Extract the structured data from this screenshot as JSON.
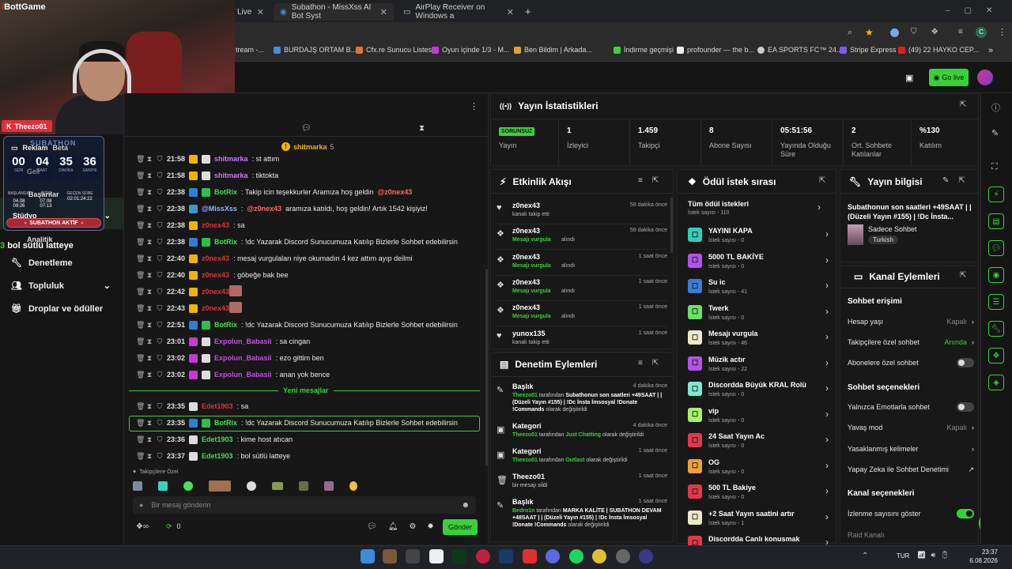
{
  "tabs": [
    {
      "label": "Live"
    },
    {
      "label": "Subathon - MissXss AI Bot Syst"
    },
    {
      "label": "AirPlay Receiver on Windows a"
    }
  ],
  "bookmarks": [
    {
      "label": "tream -..."
    },
    {
      "label": "BURDAJŞ ORTAM B..."
    },
    {
      "label": "Cfx.re Sunucu Listesi"
    },
    {
      "label": "Oyun içinde 1/3 - M..."
    },
    {
      "label": "Ben Bildim | Arkada..."
    },
    {
      "label": "İndirme geçmişi"
    },
    {
      "label": "profounder — the b..."
    },
    {
      "label": "EA SPORTS FC™ 24..."
    },
    {
      "label": "Stripe Express"
    },
    {
      "label": "(49) 22 HAYKO CEP..."
    }
  ],
  "topnav": {
    "go_live": "Go live"
  },
  "overlay": {
    "brand": "BottGame",
    "username": "Theezo01",
    "reklam": "Reklam",
    "beta": "Beta",
    "subathon_title": "SUBATHON",
    "timer": [
      {
        "v": "00",
        "l": "GÜN"
      },
      {
        "v": "04",
        "l": "SAAT"
      },
      {
        "v": "35",
        "l": "DAKİKA"
      },
      {
        "v": "36",
        "l": "SANİYE"
      }
    ],
    "geli": "Geli",
    "basarilar": "Başarılar",
    "stats": [
      {
        "l": "BAŞLANGIÇ",
        "v": "04.08",
        "v2": "09:26"
      },
      {
        "l": "BİTİŞ",
        "v": "07.08",
        "v2": "07:13"
      },
      {
        "l": "GEÇEN SÜRE",
        "v": "02:01:24:22"
      }
    ],
    "studyo": "Stüdyo",
    "aktif": "SUBATHON AKTİF",
    "analitik": "Analitik",
    "latteye": "bol sütlü latteye"
  },
  "sidebar": {
    "items": [
      {
        "label": "Denetleme"
      },
      {
        "label": "Topluluk"
      },
      {
        "label": "Droplar ve ödüller"
      }
    ]
  },
  "chat": {
    "pinned_user": "shitmarka",
    "pinned_count": "5",
    "messages": [
      {
        "time": "21:58",
        "user": "shitmarka",
        "text": ": st attım",
        "color": "#c879ff",
        "b": [
          "g",
          "w"
        ]
      },
      {
        "time": "21:58",
        "user": "shitmarka",
        "text": ": tiktokta",
        "color": "#c879ff",
        "b": [
          "g",
          "w"
        ]
      },
      {
        "time": "22:38",
        "user": "BotRix",
        "text": ": Takip icin teşekkurler Aramıza hoş geldin ",
        "mention": "@z0nex43",
        "color": "#3fe04f",
        "b": [
          "bl",
          "gr"
        ]
      },
      {
        "time": "22:38",
        "user": "@MissXss",
        "text": ": ",
        "mention": "@z0nex43",
        "after": " aramıza katıldı, hoş geldin! Artık 1542 kişiyiz!",
        "color": "#8fb7ff",
        "b": [
          "c"
        ]
      },
      {
        "time": "22:38",
        "user": "z0nex43",
        "text": ": sa",
        "color": "#e0343a",
        "b": [
          "g"
        ]
      },
      {
        "time": "22:38",
        "user": "BotRix",
        "text": ": !dc Yazarak Discord Sunucumuza Katılıp Bizlerle Sohbet edebilirsin",
        "color": "#3fe04f",
        "b": [
          "bl",
          "gr"
        ]
      },
      {
        "time": "22:40",
        "user": "z0nex43",
        "text": ": mesaj vurgulaları niye okumadın 4 kez attım ayıp deilmi",
        "color": "#e0343a",
        "b": [
          "g"
        ]
      },
      {
        "time": "22:40",
        "user": "z0nex43",
        "text": ": göbeğe bak bee",
        "color": "#e0343a",
        "b": [
          "g"
        ]
      },
      {
        "time": "22:42",
        "user": "z0nex43",
        "text": ":",
        "color": "#e0343a",
        "b": [
          "g"
        ]
      },
      {
        "time": "22:43",
        "user": "z0nex43",
        "text": ":",
        "color": "#e0343a",
        "b": [
          "g"
        ]
      },
      {
        "time": "22:51",
        "user": "BotRix",
        "text": ": !dc Yazarak Discord Sunucumuza Katılıp Bizlerle Sohbet edebilirsin",
        "color": "#3fe04f",
        "b": [
          "bl",
          "gr"
        ]
      },
      {
        "time": "23:01",
        "user": "Expolun_Babasii",
        "text": ": sa cingan",
        "color": "#c34fe0",
        "b": [
          "p",
          "w"
        ]
      },
      {
        "time": "23:02",
        "user": "Expolun_Babasii",
        "text": ": ezo gittim ben",
        "color": "#c34fe0",
        "b": [
          "p",
          "w"
        ]
      },
      {
        "time": "23:02",
        "user": "Expolun_Babasii",
        "text": ": anan yok bence",
        "color": "#c34fe0",
        "b": [
          "p",
          "w"
        ]
      }
    ],
    "new_messages": "Yeni mesajlar",
    "messages2": [
      {
        "time": "23:35",
        "user": "Edet1903",
        "text": ": sa",
        "color": "#e0343a",
        "b": [
          "w"
        ]
      },
      {
        "time": "23:35",
        "user": "BotRix",
        "text": ": !dc Yazarak Discord Sunucumuza Katılıp Bizlerle Sohbet edebilirsin",
        "color": "#3fe04f",
        "b": [
          "bl",
          "gr"
        ]
      },
      {
        "time": "23:36",
        "user": "Edet1903",
        "text": ": kime host atıcan",
        "color": "#3fe04f",
        "b": [
          "w"
        ]
      },
      {
        "time": "23:37",
        "user": "Edet1903",
        "text": ": bol sütlü latteye",
        "color": "#3fe04f",
        "b": [
          "w"
        ]
      }
    ],
    "follower_label": "Takipçilere Özel",
    "input_placeholder": "Bir mesaj gönderin",
    "points": "0",
    "send": "Gönder"
  },
  "stream_stats": {
    "title": "Yayın İstatistikleri",
    "items": [
      {
        "v": "SORUNSUZ",
        "l": "Yayın"
      },
      {
        "v": "1",
        "l": "İzleyici"
      },
      {
        "v": "1.459",
        "l": "Takipçi"
      },
      {
        "v": "8",
        "l": "Abone Sayısı"
      },
      {
        "v": "05:51:56",
        "l": "Yayında Olduğu Süre"
      },
      {
        "v": "2",
        "l": "Ort. Sohbete Katılanlar"
      },
      {
        "v": "%130",
        "l": "Katılım"
      }
    ]
  },
  "activity": {
    "title": "Etkinlik Akışı",
    "rows": [
      {
        "n": "z0nex43",
        "s": "kanalı takip etti",
        "t": "58 dakika önce",
        "hl": false,
        "icon": "♥"
      },
      {
        "n": "z0nex43",
        "s": "Mesajı vurgula",
        "s2": " alındı",
        "t": "59 dakika önce",
        "hl": true,
        "icon": "❖"
      },
      {
        "n": "z0nex43",
        "s": "Mesajı vurgula",
        "s2": " alındı",
        "t": "1 saat önce",
        "hl": true,
        "icon": "❖"
      },
      {
        "n": "z0nex43",
        "s": "Mesajı vurgula",
        "s2": " alındı",
        "t": "1 saat önce",
        "hl": true,
        "icon": "❖"
      },
      {
        "n": "z0nex43",
        "s": "Mesajı vurgula",
        "s2": " alındı",
        "t": "1 saat önce",
        "hl": true,
        "icon": "❖"
      },
      {
        "n": "yunox135",
        "s": "kanalı takip etti",
        "t": "1 saat önce",
        "hl": false,
        "icon": "♥"
      }
    ]
  },
  "moderation": {
    "title": "Denetim Eylemleri",
    "rows": [
      {
        "n": "Başlık",
        "t": "4 dakika önce",
        "u": "Theezo01",
        "d": " tarafından ",
        "v": "Subathonun son saatleri +49SAAT | | (Düzeli Yayın #155) | !Dc İnsta İmsosyal !Donate !Commands",
        "e": " olarak değiştirildi"
      },
      {
        "n": "Kategori",
        "t": "4 dakika önce",
        "u": "Theezo01",
        "d": " tarafından ",
        "hl": "Just Chatting",
        "e": " olarak değiştirildi"
      },
      {
        "n": "Kategori",
        "t": "1 saat önce",
        "u": "Theezo01",
        "d": " tarafından ",
        "hl": "Outlast",
        "e": " olarak değiştirildi"
      },
      {
        "n": "Theezo01",
        "t": "1 saat önce",
        "sub": "bir mesajı sildi"
      },
      {
        "n": "Başlık",
        "t": "1 saat önce",
        "u": "Bedro1n",
        "d": " tarafından ",
        "v": "MARKA KALİTE | SUBATHON DEVAM +48SAAT | | (Düzeli Yayın #155) | !Dc İnsta İmsosyal !Donate !Commands",
        "e": " olarak değiştirildi"
      }
    ]
  },
  "rewards": {
    "title": "Ödül istek sırası",
    "all": "Tüm ödül istekleri",
    "all_count": "İstek sayısı - 110",
    "items": [
      {
        "n": "YAYINI KAPA",
        "s": "İstek sayısı - 0",
        "c": "#2fd0b8"
      },
      {
        "n": "5000 TL BAKİYE",
        "s": "İstek sayısı - 0",
        "c": "#b255e6"
      },
      {
        "n": "Su ic",
        "s": "İstek sayısı - 41",
        "c": "#3a7fd6"
      },
      {
        "n": "Twerk",
        "s": "İstek sayısı - 0",
        "c": "#6ee06a"
      },
      {
        "n": "Mesajı vurgula",
        "s": "İstek sayısı - 46",
        "c": "#efe9c9"
      },
      {
        "n": "Müzik actır",
        "s": "İstek sayısı - 22",
        "c": "#b255e6"
      },
      {
        "n": "Discordda Büyük KRAL Rolü",
        "s": "İstek sayısı - 0",
        "c": "#7ee8d0"
      },
      {
        "n": "vip",
        "s": "İstek sayısı - 0",
        "c": "#a8f070"
      },
      {
        "n": "24 Saat Yayın Ac",
        "s": "İstek sayısı - 0",
        "c": "#e03a4a"
      },
      {
        "n": "OG",
        "s": "İstek sayısı - 0",
        "c": "#f0a03a"
      },
      {
        "n": "500 TL Bakiye",
        "s": "İstek sayısı - 0",
        "c": "#e03a4a"
      },
      {
        "n": "+2 Saat Yayın saatini artır",
        "s": "İstek sayısı - 1",
        "c": "#efe9c9"
      },
      {
        "n": "Discordda Canlı konusmak",
        "s": "",
        "c": "#e03a4a"
      }
    ]
  },
  "stream_info": {
    "title": "Yayın bilgisi",
    "desc": "Subathonun son saatleri +49SAAT | | (Düzeli Yayın #155) | !Dc İnsta...",
    "category": "Sadece Sohbet",
    "lang": "Turkish"
  },
  "channel": {
    "title": "Kanal Eylemleri",
    "chat_access": "Sohbet erişimi",
    "rows1": [
      {
        "l": "Hesap yaşı",
        "v": "Kapalı"
      },
      {
        "l": "Takipçilere özel sohbet",
        "v": "Anında",
        "green": true
      }
    ],
    "sub_only": "Abonelere özel sohbet",
    "chat_options": "Sohbet seçenekleri",
    "emote_only": "Yalnızca Emotlarla sohbet",
    "slow": "Yavaş mod",
    "slow_v": "Kapalı",
    "banned": "Yasaklanmış kelimeler",
    "ai": "Yapay Zeka ile Sohbet Denetimi",
    "channel_options": "Kanal seçenekleri",
    "show_views": "İzlenme sayısını göster",
    "raid": "Raid Kanalı"
  },
  "taskbar": {
    "lang": "TUR",
    "time": "23:37",
    "date": "6.08.2026"
  },
  "colors": {
    "accent": "#39d13a"
  }
}
